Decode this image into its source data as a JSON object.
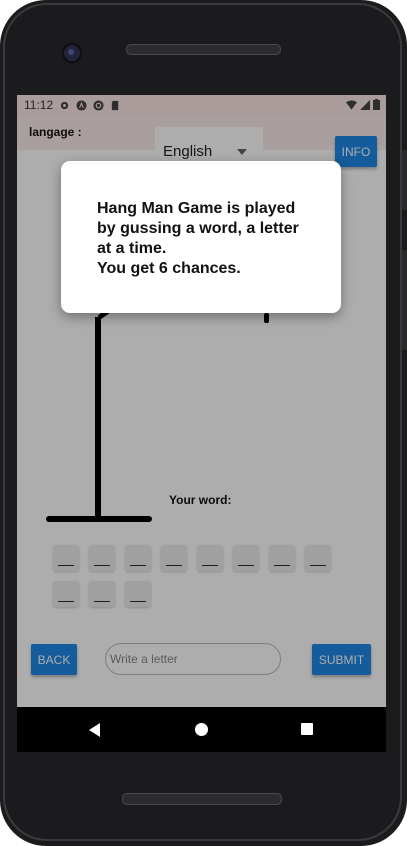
{
  "status_bar": {
    "time": "11:12",
    "left_icons": [
      "settings-icon",
      "a-circle-icon",
      "sync-circle-icon",
      "sd-card-icon"
    ],
    "right_icons": [
      "wifi-icon",
      "signal-icon",
      "battery-icon"
    ]
  },
  "app_bar": {
    "language_label": "langage :",
    "language_selected": "English",
    "info_label": "INFO",
    "background_color": "#fbeaea",
    "accent_color": "#1e88e5"
  },
  "game": {
    "word_label": "Your word:",
    "slots": [
      "__",
      "__",
      "__",
      "__",
      "__",
      "__",
      "__",
      "__",
      "__",
      "__",
      "__"
    ],
    "back_label": "BACK",
    "submit_label": "SUBMIT",
    "input_placeholder": "Write a letter",
    "input_value": ""
  },
  "dialog": {
    "message": "Hang Man Game is played\nby gussing a word, a letter\nat a time.\nYou get 6 chances."
  },
  "nav_bar": {
    "icons": [
      "back-triangle-icon",
      "home-circle-icon",
      "recents-square-icon"
    ]
  }
}
